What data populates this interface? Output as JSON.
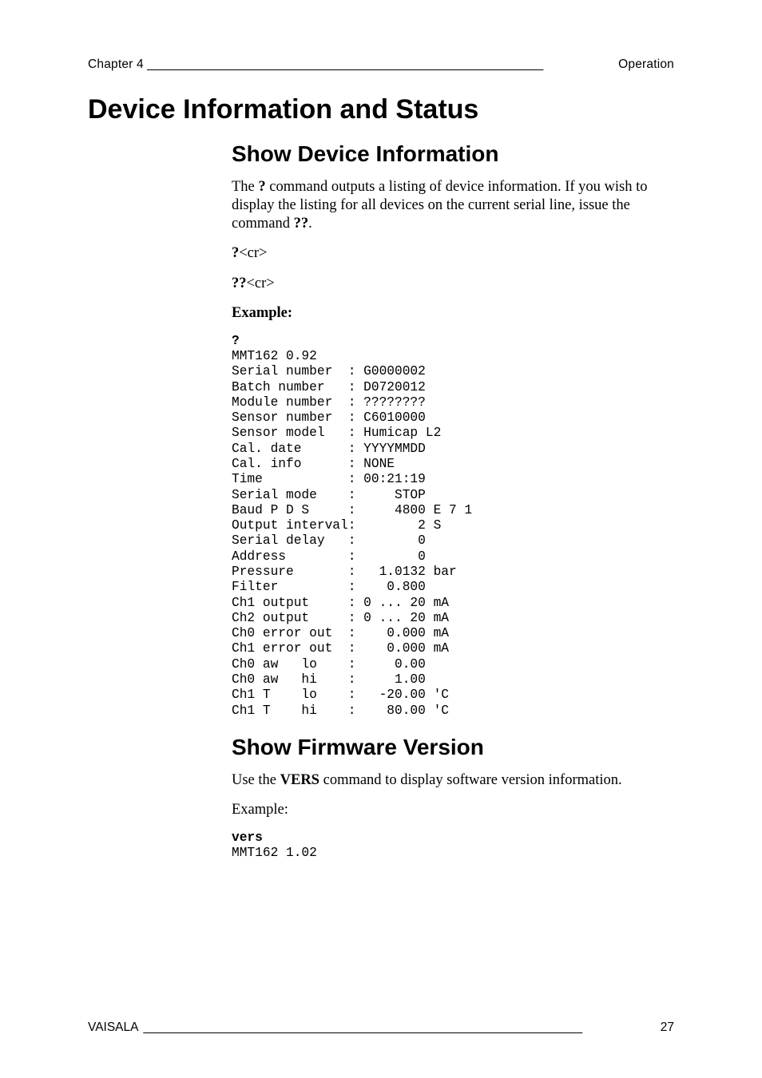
{
  "header": {
    "left": "Chapter 4",
    "right": "Operation"
  },
  "h1": "Device Information and Status",
  "section1": {
    "title": "Show Device Information",
    "para": "The ? command outputs a listing of device information. If you wish to display the listing for all devices on the current serial line, issue the command ??.",
    "cmd1_bold": "?",
    "cmd1_rest": "<cr>",
    "cmd2_bold": "??",
    "cmd2_rest": "<cr>",
    "example_label": "Example:",
    "terminal": "?\nMMT162 0.92\nSerial number  : G0000002\nBatch number   : D0720012\nModule number  : ????????\nSensor number  : C6010000\nSensor model   : Humicap L2\nCal. date      : YYYYMMDD\nCal. info      : NONE\nTime           : 00:21:19\nSerial mode    :     STOP\nBaud P D S     :     4800 E 7 1\nOutput interval:        2 S\nSerial delay   :        0\nAddress        :        0\nPressure       :   1.0132 bar\nFilter         :    0.800\nCh1 output     : 0 ... 20 mA\nCh2 output     : 0 ... 20 mA\nCh0 error out  :    0.000 mA\nCh1 error out  :    0.000 mA\nCh0 aw   lo    :     0.00\nCh0 aw   hi    :     1.00\nCh1 T    lo    :   -20.00 'C\nCh1 T    hi    :    80.00 'C"
  },
  "section2": {
    "title": "Show Firmware Version",
    "para_pre": "Use the ",
    "para_cmd": "VERS",
    "para_post": " command to display software version information.",
    "example_label": "Example:",
    "terminal": "vers\nMMT162 1.02"
  },
  "footer": {
    "left": "VAISALA",
    "right": "27"
  }
}
